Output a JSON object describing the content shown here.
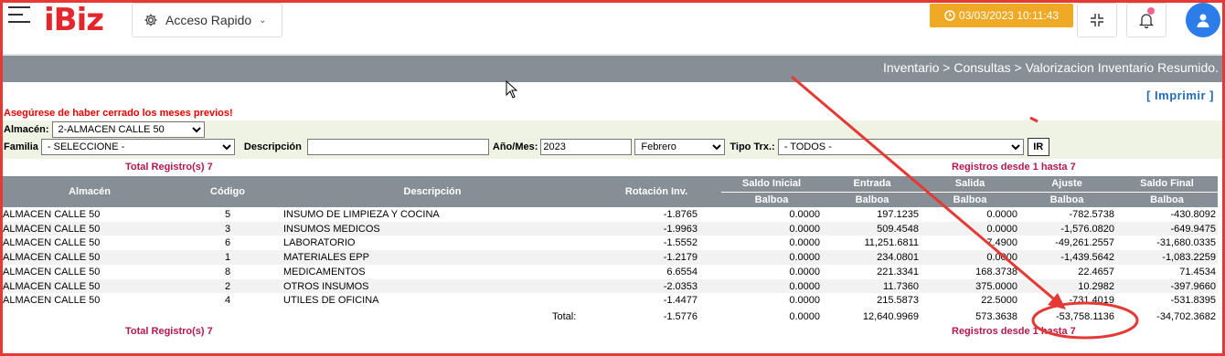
{
  "app": {
    "logo": "iBiz",
    "accent": "#e4262d"
  },
  "header": {
    "acceso_label": "Acceso Rapido",
    "datetime": "03/03/2023 10:11:43"
  },
  "breadcrumb": "Inventario > Consultas > Valorizacion Inventario Resumido.",
  "imprimir": "[ Imprimir ]",
  "warning": "Asegúrese de haber cerrado los meses previos!",
  "filters": {
    "almacen_label": "Almacén:",
    "almacen_value": "2-ALMACEN CALLE 50",
    "familia_label": "Familia",
    "familia_value": "- SELECCIONE -",
    "descripcion_label": "Descripción",
    "descripcion_value": "",
    "anio_mes_label": "Año/Mes:",
    "anio_value": "2023",
    "mes_value": "Febrero",
    "tipo_label": "Tipo Trx.:",
    "tipo_value": "- TODOS -",
    "ir_label": "IR"
  },
  "table": {
    "total_registros": "Total Registro(s) 7",
    "registros_rango": "Registros desde 1 hasta 7",
    "headers": {
      "almacen": "Almacén",
      "codigo": "Código",
      "descripcion": "Descripción",
      "rotacion": "Rotación Inv.",
      "saldo_inicial": "Saldo Inicial",
      "entrada": "Entrada",
      "salida": "Salida",
      "ajuste": "Ajuste",
      "saldo_final": "Saldo Final",
      "currency": "Balboa"
    },
    "rows": [
      [
        "ALMACEN CALLE 50",
        "5",
        "INSUMO DE LIMPIEZA Y COCINA",
        "-1.8765",
        "0.0000",
        "197.1235",
        "0.0000",
        "-782.5738",
        "-430.8092"
      ],
      [
        "ALMACEN CALLE 50",
        "3",
        "INSUMOS MEDICOS",
        "-1.9963",
        "0.0000",
        "509.4548",
        "0.0000",
        "-1,576.0820",
        "-649.9475"
      ],
      [
        "ALMACEN CALLE 50",
        "6",
        "LABORATORIO",
        "-1.5552",
        "0.0000",
        "11,251.6811",
        "7.4900",
        "-49,261.2557",
        "-31,680.0335"
      ],
      [
        "ALMACEN CALLE 50",
        "1",
        "MATERIALES EPP",
        "-1.2179",
        "0.0000",
        "234.0801",
        "0.0000",
        "-1,439.5642",
        "-1,083.2259"
      ],
      [
        "ALMACEN CALLE 50",
        "8",
        "MEDICAMENTOS",
        "6.6554",
        "0.0000",
        "221.3341",
        "168.3738",
        "22.4657",
        "71.4534"
      ],
      [
        "ALMACEN CALLE 50",
        "2",
        "OTROS INSUMOS",
        "-2.0353",
        "0.0000",
        "11.7360",
        "375.0000",
        "10.2982",
        "-397.9660"
      ],
      [
        "ALMACEN CALLE 50",
        "4",
        "UTILES DE OFICINA",
        "-1.4477",
        "0.0000",
        "215.5873",
        "22.5000",
        "-731.4019",
        "-531.8395"
      ]
    ],
    "total": {
      "label": "Total:",
      "rotacion": "-1.5776",
      "saldo_inicial": "0.0000",
      "entrada": "12,640.9969",
      "salida": "573.3638",
      "ajuste": "-53,758.1136",
      "saldo_final": "-34,702.3682"
    }
  }
}
